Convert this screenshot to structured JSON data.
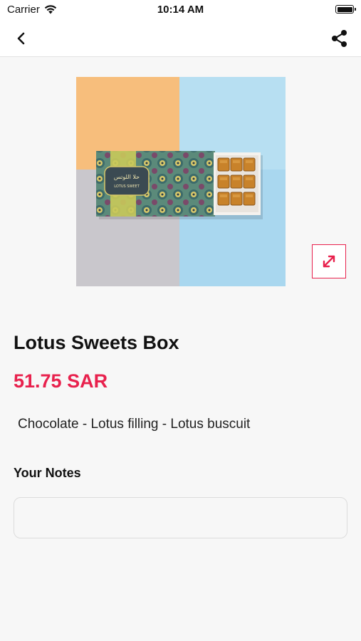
{
  "status_bar": {
    "carrier": "Carrier",
    "time": "10:14 AM"
  },
  "nav": {
    "back_icon": "chevron-left-icon",
    "share_icon": "share-icon"
  },
  "product": {
    "title": "Lotus Sweets Box",
    "price": "51.75 SAR",
    "description": "Chocolate - Lotus filling - Lotus buscuit",
    "box_label_arabic": "حلا اللوتس",
    "box_label_english": "LOTUS SWEET"
  },
  "notes": {
    "label": "Your Notes",
    "value": "",
    "placeholder": ""
  },
  "colors": {
    "accent": "#e8214d",
    "background": "#f7f7f7"
  }
}
